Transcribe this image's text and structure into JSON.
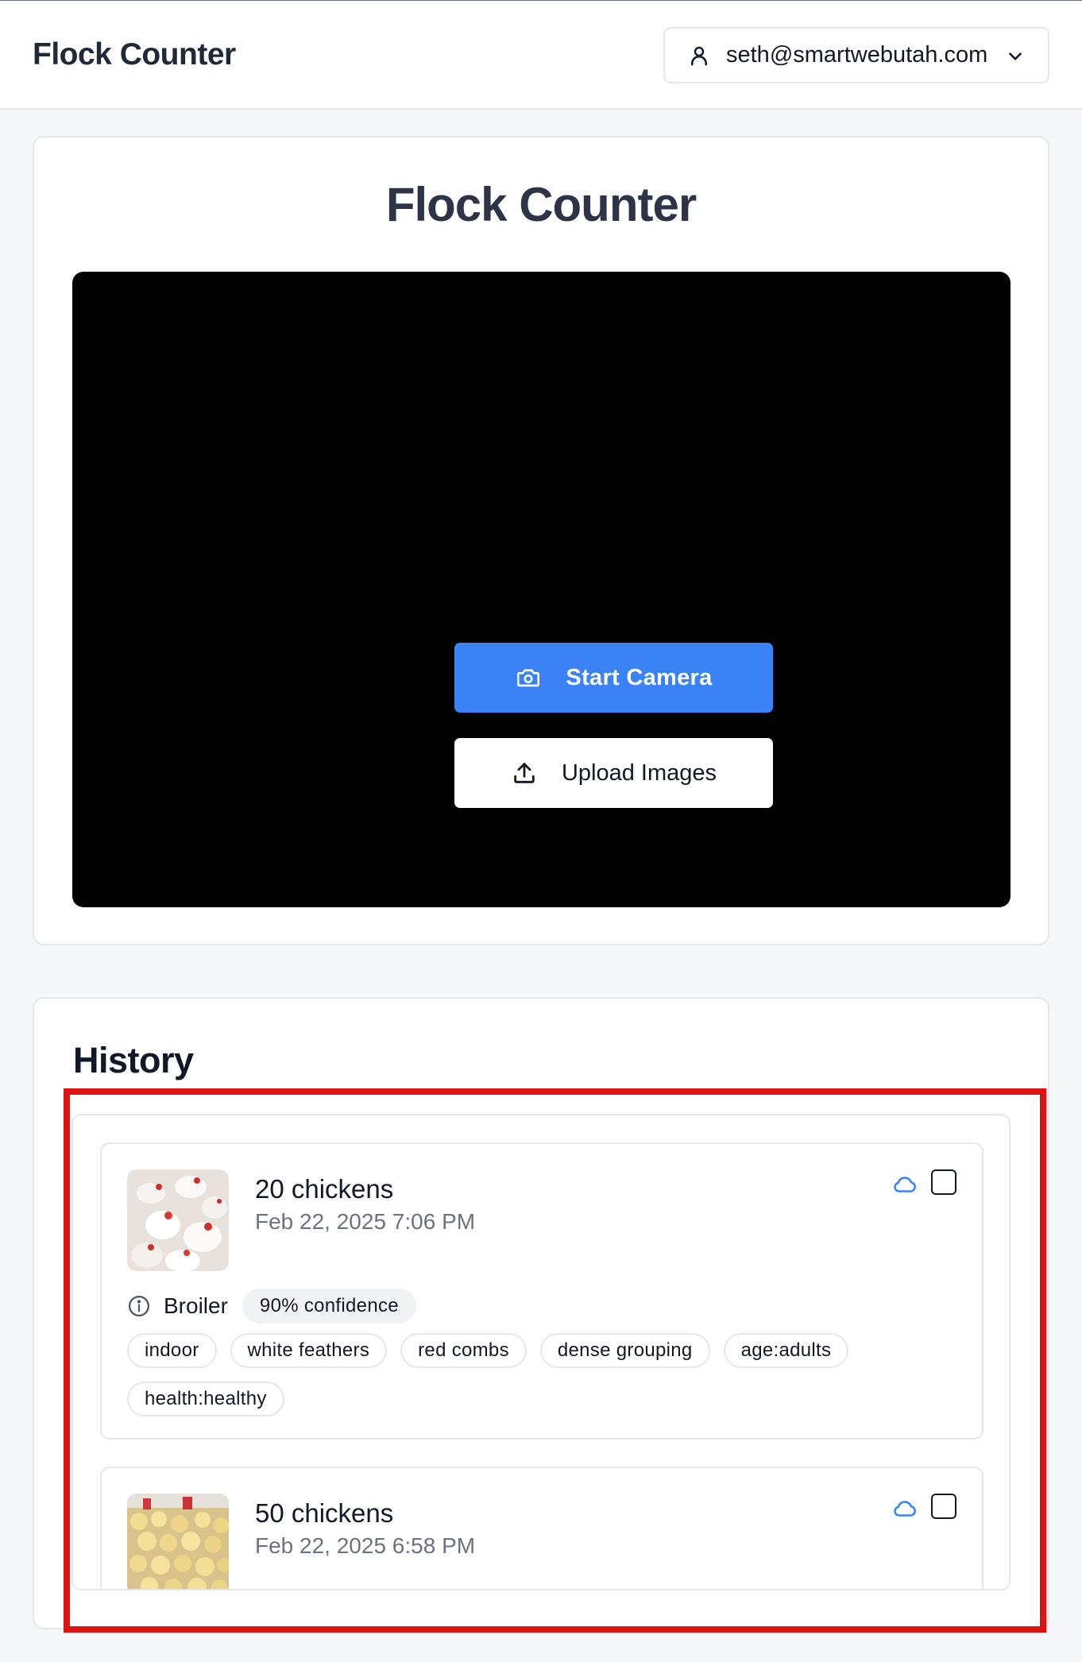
{
  "header": {
    "brand": "Flock Counter",
    "account_email": "seth@smartwebutah.com"
  },
  "main": {
    "title": "Flock Counter",
    "start_camera_label": "Start Camera",
    "upload_images_label": "Upload Images"
  },
  "history": {
    "title": "History",
    "entries": [
      {
        "count": "20 chickens",
        "date": "Feb 22, 2025 7:06 PM",
        "breed": "Broiler",
        "confidence": "90% confidence",
        "tags": [
          "indoor",
          "white feathers",
          "red combs",
          "dense grouping",
          "age:adults",
          "health:healthy"
        ]
      },
      {
        "count": "50 chickens",
        "date": "Feb 22, 2025 6:58 PM"
      }
    ]
  },
  "colors": {
    "accent": "#3b82f6",
    "highlight": "#e01111",
    "cloud": "#3b82f6"
  }
}
